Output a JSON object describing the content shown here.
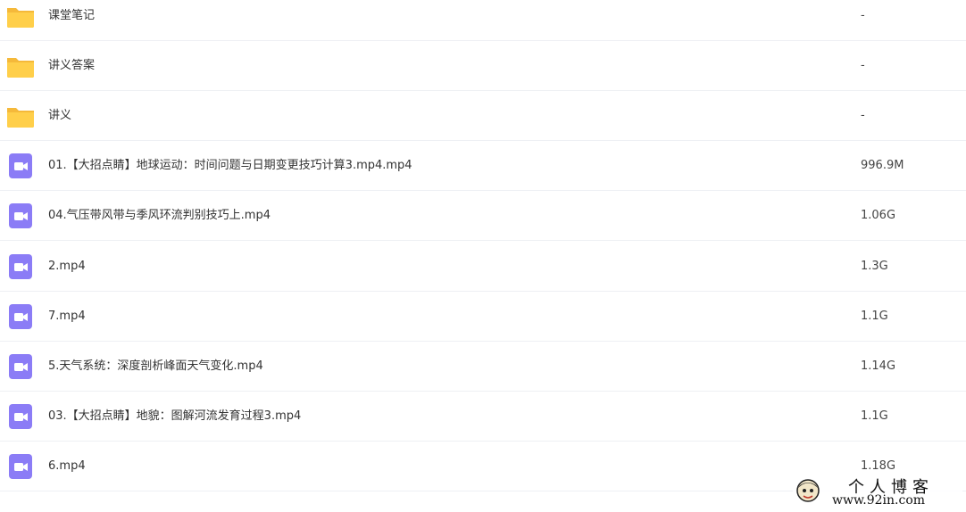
{
  "colors": {
    "folder_icon": "#FFCF4A",
    "folder_tab": "#F5B93A",
    "video_icon": "#8B7CF6",
    "row_divider": "#EEF0F4"
  },
  "files": [
    {
      "type": "folder",
      "icon": "folder-icon",
      "name": "课堂笔记",
      "size": "-"
    },
    {
      "type": "folder",
      "icon": "folder-icon",
      "name": "讲义答案",
      "size": "-"
    },
    {
      "type": "folder",
      "icon": "folder-icon",
      "name": "讲义",
      "size": "-"
    },
    {
      "type": "video",
      "icon": "video-file-icon",
      "name": "01.【大招点睛】地球运动：时间问题与日期变更技巧计算3.mp4.mp4",
      "size": "996.9M"
    },
    {
      "type": "video",
      "icon": "video-file-icon",
      "name": "04.气压带风带与季风环流判别技巧上.mp4",
      "size": "1.06G"
    },
    {
      "type": "video",
      "icon": "video-file-icon",
      "name": "2.mp4",
      "size": "1.3G"
    },
    {
      "type": "video",
      "icon": "video-file-icon",
      "name": "7.mp4",
      "size": "1.1G"
    },
    {
      "type": "video",
      "icon": "video-file-icon",
      "name": "5.天气系统：深度剖析峰面天气变化.mp4",
      "size": "1.14G"
    },
    {
      "type": "video",
      "icon": "video-file-icon",
      "name": "03.【大招点睛】地貌：图解河流发育过程3.mp4",
      "size": "1.1G"
    },
    {
      "type": "video",
      "icon": "video-file-icon",
      "name": "6.mp4",
      "size": "1.18G"
    }
  ],
  "watermark": {
    "title": "个人博客",
    "url": "www.92in.com"
  }
}
